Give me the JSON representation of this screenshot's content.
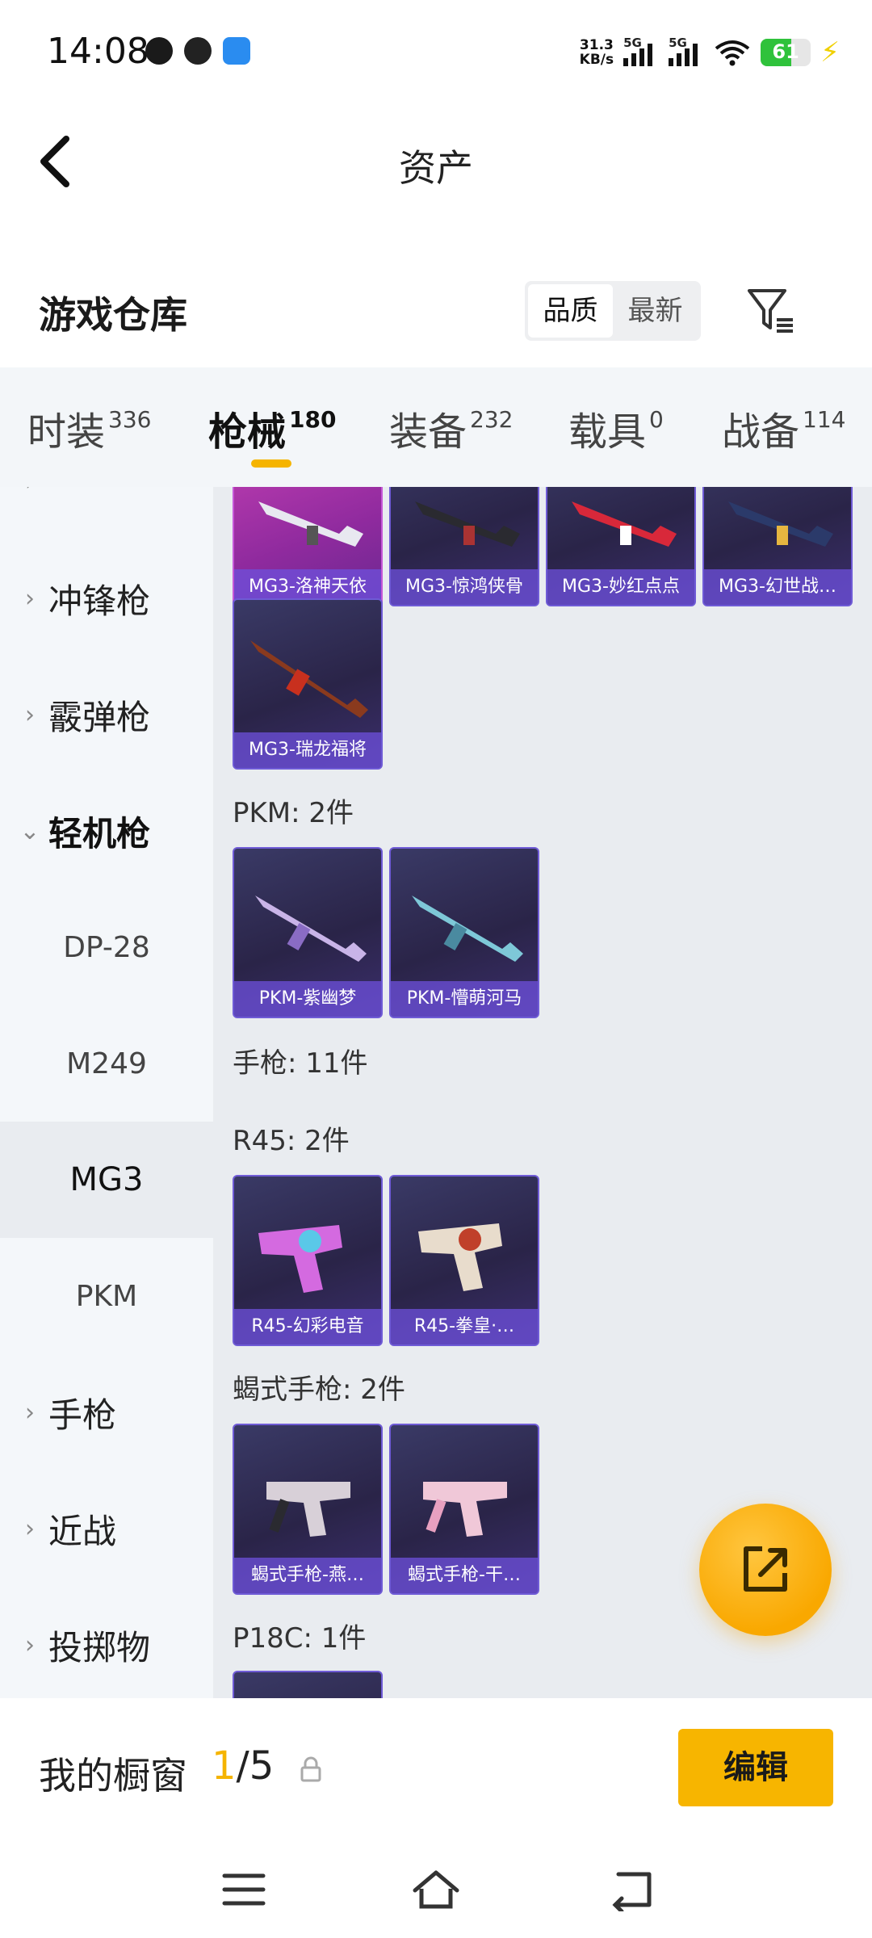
{
  "status_bar": {
    "time": "14:08",
    "net_speed_value": "31.3",
    "net_speed_unit": "KB/s",
    "sim1": "5G",
    "sim2": "5G",
    "battery": "61",
    "icons": [
      "sim-card-icon",
      "network-icon",
      "nfc-icon",
      "signal-icon",
      "wifi-icon",
      "battery-icon",
      "charging-icon"
    ]
  },
  "header": {
    "title": "资产"
  },
  "warehouse": {
    "title": "游戏仓库",
    "sort_options": [
      "品质",
      "最新"
    ],
    "sort_selected": "品质"
  },
  "tabs": [
    {
      "label": "时装",
      "count": "336"
    },
    {
      "label": "枪械",
      "count": "180"
    },
    {
      "label": "装备",
      "count": "232"
    },
    {
      "label": "载具",
      "count": "0"
    },
    {
      "label": "战备",
      "count": "114"
    }
  ],
  "tab_active": "枪械",
  "sidebar": {
    "categories": [
      {
        "label": "冲锋枪",
        "expanded": false
      },
      {
        "label": "霰弹枪",
        "expanded": false
      },
      {
        "label": "轻机枪",
        "expanded": true
      },
      {
        "label": "手枪",
        "expanded": false
      },
      {
        "label": "近战",
        "expanded": false
      },
      {
        "label": "投掷物",
        "expanded": false
      }
    ],
    "subitems": [
      "DP-28",
      "M249",
      "MG3",
      "PKM"
    ],
    "active_subitem": "MG3"
  },
  "content": {
    "mg3_items": [
      "MG3-洛神天依",
      "MG3-惊鸿侠骨",
      "MG3-妙红点点",
      "MG3-幻世战…",
      "MG3-瑞龙福将"
    ],
    "pkm_label": "PKM: 2件",
    "pkm_items": [
      "PKM-紫幽梦",
      "PKM-懵萌河马"
    ],
    "pistol_label": "手枪: 11件",
    "r45_label": "R45: 2件",
    "r45_items": [
      "R45-幻彩电音",
      "R45-拳皇·…"
    ],
    "scorpion_label": "蝎式手枪: 2件",
    "scorpion_items": [
      "蝎式手枪-燕…",
      "蝎式手枪-干…"
    ],
    "p18c_label": "P18C: 1件"
  },
  "showcase": {
    "label": "我的橱窗",
    "current": "1",
    "total": "/5",
    "edit_label": "编辑"
  },
  "colors": {
    "accent": "#f5b400",
    "card_border": "#6f5bd6",
    "card_pink": "#c23fb2"
  }
}
